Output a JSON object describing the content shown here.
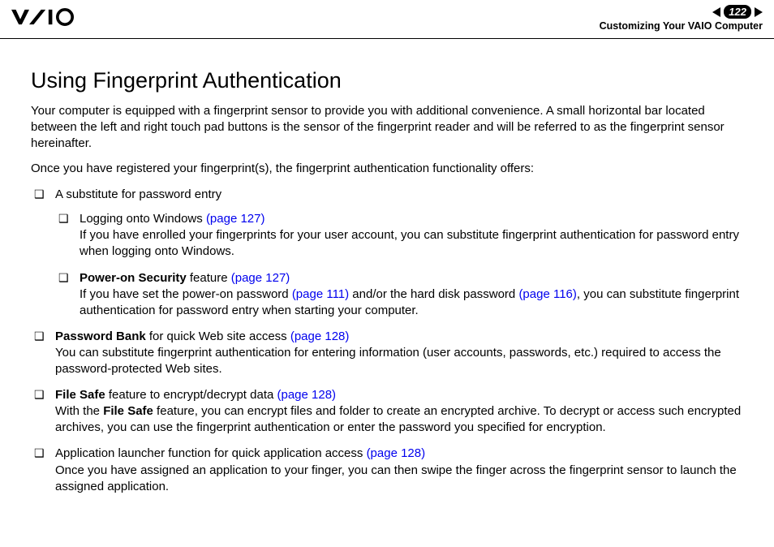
{
  "header": {
    "page_number": "122",
    "section": "Customizing Your VAIO Computer"
  },
  "title": "Using Fingerprint Authentication",
  "intro1": "Your computer is equipped with a fingerprint sensor to provide you with additional convenience. A small horizontal bar located between the left and right touch pad buttons is the sensor of the fingerprint reader and will be referred to as the fingerprint sensor hereinafter.",
  "intro2": "Once you have registered your fingerprint(s), the fingerprint authentication functionality offers:",
  "list": {
    "item1": {
      "text": "A substitute for password entry",
      "sub1": {
        "prefix": "Logging onto Windows ",
        "link": "(page 127)",
        "body": "If you have enrolled your fingerprints for your user account, you can substitute fingerprint authentication for password entry when logging onto Windows."
      },
      "sub2": {
        "bold": "Power-on Security",
        "after_bold": " feature ",
        "link1": "(page 127)",
        "body_a": "If you have set the power-on password ",
        "link2": "(page 111)",
        "body_b": " and/or the hard disk password ",
        "link3": "(page 116)",
        "body_c": ", you can substitute fingerprint authentication for password entry when starting your computer."
      }
    },
    "item2": {
      "bold": "Password Bank",
      "after_bold": " for quick Web site access ",
      "link": "(page 128)",
      "body": "You can substitute fingerprint authentication for entering information (user accounts, passwords, etc.) required to access the password-protected Web sites."
    },
    "item3": {
      "bold": "File Safe",
      "after_bold": " feature to encrypt/decrypt data ",
      "link": "(page 128)",
      "body_a": "With the ",
      "bold2": "File Safe",
      "body_b": " feature, you can encrypt files and folder to create an encrypted archive. To decrypt or access such encrypted archives, you can use the fingerprint authentication or enter the password you specified for encryption."
    },
    "item4": {
      "prefix": "Application launcher function for quick application access ",
      "link": "(page 128)",
      "body": "Once you have assigned an application to your finger, you can then swipe the finger across the fingerprint sensor to launch the assigned application."
    }
  }
}
